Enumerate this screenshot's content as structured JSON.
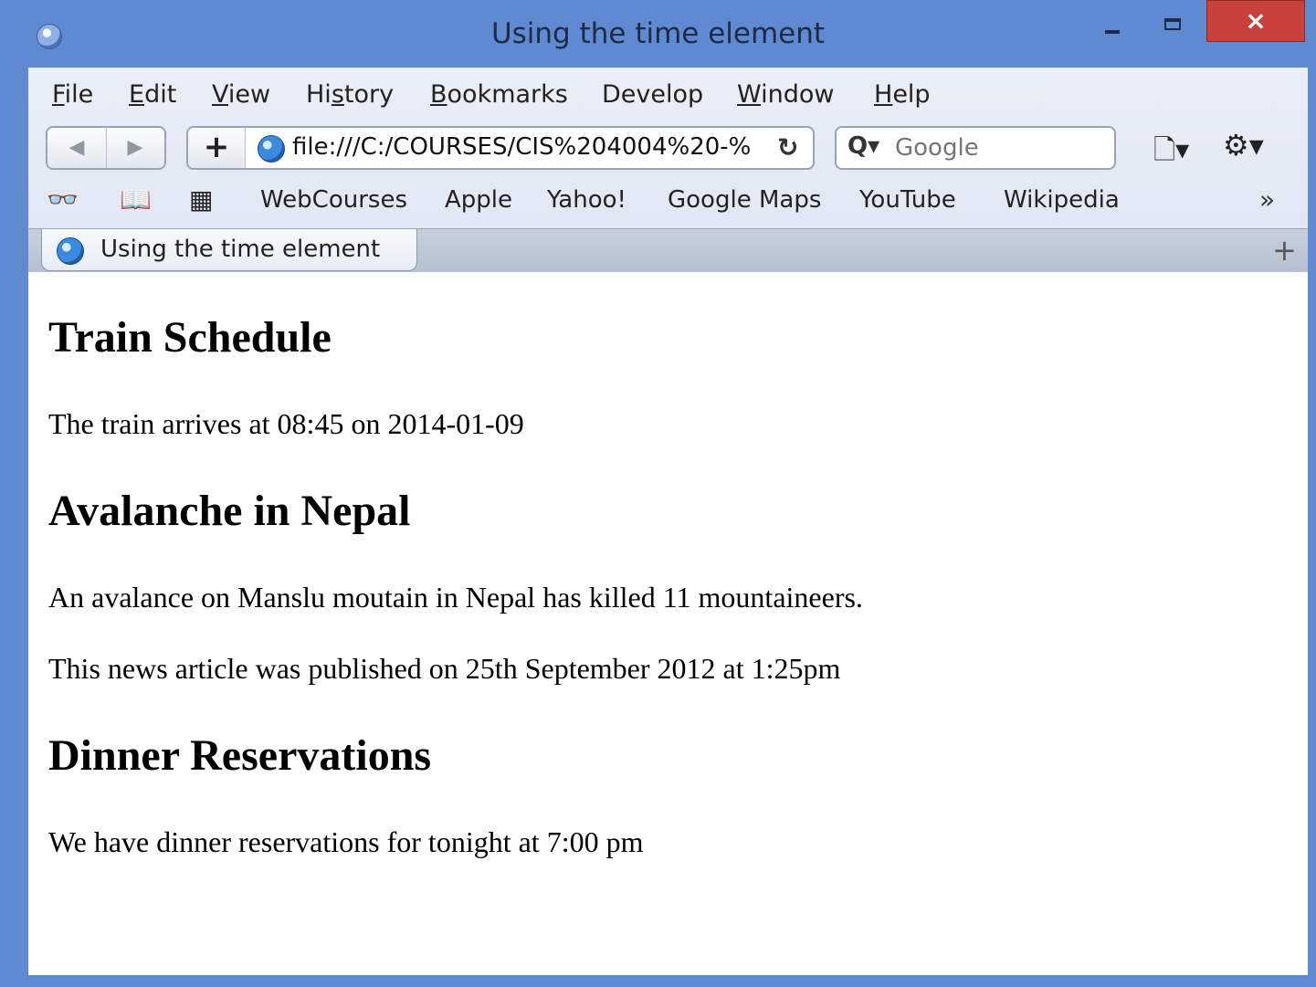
{
  "window": {
    "title": "Using the time element",
    "close_label": "×"
  },
  "menu": {
    "items": [
      {
        "label": "File",
        "underline": "F",
        "rest": "ile"
      },
      {
        "label": "Edit",
        "underline": "E",
        "rest": "dit"
      },
      {
        "label": "View",
        "underline": "V",
        "rest": "iew"
      },
      {
        "label": "History",
        "pre": "Hi",
        "underline": "s",
        "rest": "tory"
      },
      {
        "label": "Bookmarks",
        "underline": "B",
        "rest": "ookmarks"
      },
      {
        "label": "Develop"
      },
      {
        "label": "Window",
        "underline": "W",
        "rest": "indow"
      },
      {
        "label": "Help",
        "underline": "H",
        "rest": "elp"
      }
    ]
  },
  "nav": {
    "back_label": "◀",
    "forward_label": "▶",
    "add_label": "+",
    "url": "file:///C:/COURSES/CIS%204004%20-%",
    "reload_label": "↻",
    "search_placeholder": "Google",
    "search_icon_label": "Q▾",
    "page_menu_label": "🗋▾",
    "gear_label": "⚙▾"
  },
  "bookmarks": {
    "reader_icon": "👓",
    "book_icon": "📖",
    "grid_icon": "▦",
    "items": [
      "WebCourses",
      "Apple",
      "Yahoo!",
      "Google Maps",
      "YouTube",
      "Wikipedia"
    ],
    "more_label": "»"
  },
  "tabs": {
    "active_label": "Using the time element",
    "new_tab_label": "+"
  },
  "content": {
    "heading1": "Train Schedule",
    "para1": "The train arrives at 08:45 on 2014-01-09",
    "heading2": "Avalanche in Nepal",
    "para2": "An avalance on Manslu moutain in Nepal has killed 11 mountaineers.",
    "para3": "This news article was published on 25th September 2012 at 1:25pm",
    "heading3": "Dinner Reservations",
    "para4": "We have dinner reservations for tonight at 7:00 pm"
  },
  "colors": {
    "frame": "#5f89d1",
    "close_button": "#c9413a"
  }
}
